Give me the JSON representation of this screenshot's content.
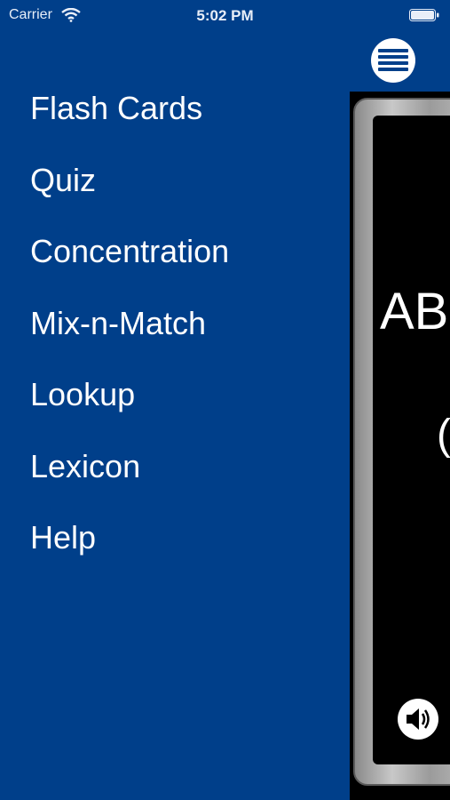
{
  "status_bar": {
    "carrier": "Carrier",
    "time": "5:02 PM",
    "wifi_icon": "wifi-icon",
    "battery_icon": "battery-icon"
  },
  "menu": {
    "items": [
      {
        "label": "Flash Cards"
      },
      {
        "label": "Quiz"
      },
      {
        "label": "Concentration"
      },
      {
        "label": "Mix-n-Match"
      },
      {
        "label": "Lookup"
      },
      {
        "label": "Lexicon"
      },
      {
        "label": "Help"
      }
    ]
  },
  "main": {
    "menu_toggle_icon": "hamburger-menu-icon",
    "card": {
      "term": "AB",
      "parenthetical": "("
    },
    "speaker_icon": "speaker-icon"
  },
  "colors": {
    "menu_background": "#003f8a",
    "card_background": "#000000",
    "text": "#ffffff"
  }
}
